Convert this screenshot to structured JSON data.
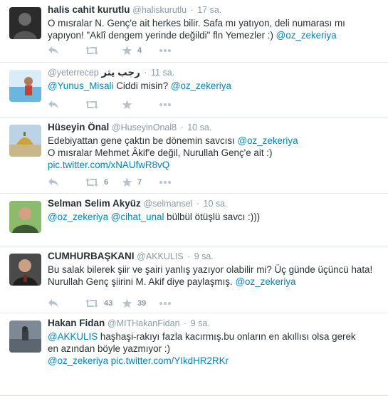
{
  "tweets": [
    {
      "fullname": "halis cahit kurutlu",
      "username": "@haliskurutlu",
      "time": "17 sa.",
      "text_lines": [
        [
          {
            "t": "O mısralar N. Genç'e ait herkes bilir. Safa mı yatıyon, deli numarası mı"
          }
        ],
        [
          {
            "t": "yapıyon! \"Aklî dengem yerinde değildi\" fln Yemezler :) "
          },
          {
            "t": "@oz_zekeriya",
            "link": true
          }
        ]
      ],
      "retweets": "",
      "favorites": "4"
    },
    {
      "fullname": "",
      "username": "@yeterrecep",
      "arabic_name": "رجب يتر",
      "time": "11 sa.",
      "text_lines": [
        [
          {
            "t": "@Yunus_Misali",
            "link": true
          },
          {
            "t": " Ciddi misin? "
          },
          {
            "t": "@oz_zekeriya",
            "link": true
          }
        ]
      ],
      "retweets": "",
      "favorites": ""
    },
    {
      "fullname": "Hüseyin Önal",
      "username": "@HuseyinOnal8",
      "time": "10 sa.",
      "text_lines": [
        [
          {
            "t": "Edebiyattan gene çaktın be dönemin savcısı "
          },
          {
            "t": "@oz_zekeriya",
            "link": true
          }
        ],
        [
          {
            "t": "O mısralar Mehmet Âkif'e değil, Nurullah Genç'e ait :)"
          }
        ],
        [
          {
            "t": "pic.twitter.com/xNAUfwR8vQ",
            "link": true
          }
        ]
      ],
      "retweets": "6",
      "favorites": "7"
    },
    {
      "fullname": "Selman Selim Akyüz",
      "username": "@selmansel",
      "time": "10 sa.",
      "text_lines": [
        [
          {
            "t": "@oz_zekeriya",
            "link": true
          },
          {
            "t": " "
          },
          {
            "t": "@cihat_unal",
            "link": true
          },
          {
            "t": " bülbül ötüşlü savcı :)))"
          }
        ]
      ],
      "retweets": "",
      "favorites": ""
    },
    {
      "fullname": "CUMHURBAŞKANI",
      "username": "@AKKULIS",
      "time": "9 sa.",
      "text_lines": [
        [
          {
            "t": "Bu salak bilerek şiir ve şairi yanlış yazıyor olabilir mi? Üç günde üçüncü hata!"
          }
        ],
        [
          {
            "t": "Nurullah Genç şiirini M. Akif diye paylaşmış. "
          },
          {
            "t": "@oz_zekeriya",
            "link": true
          }
        ]
      ],
      "retweets": "43",
      "favorites": "39"
    },
    {
      "fullname": "Hakan Fidan",
      "username": "@MITHakanFidan",
      "time": "9 sa.",
      "text_lines": [
        [
          {
            "t": "@AKKULIS",
            "link": true
          },
          {
            "t": " haşhaşi-rakıyı fazla kacırmış.bu onların en akıllısı olsa gerek"
          }
        ],
        [
          {
            "t": "en azından böyle yazmıyor :)"
          }
        ],
        [
          {
            "t": "  "
          },
          {
            "t": "@oz_zekeriya",
            "link": true
          },
          {
            "t": " "
          },
          {
            "t": "pic.twitter.com/YIkdHR2RKr",
            "link": true
          }
        ]
      ],
      "retweets": "",
      "favorites": ""
    }
  ],
  "icons": {
    "reply": "reply-icon",
    "retweet": "retweet-icon",
    "favorite": "star-icon",
    "more": "more-icon"
  },
  "colors": {
    "link": "#0084b4",
    "meta": "#8899a6",
    "icon": "#b8c4cc",
    "divider": "#e1e8ed"
  }
}
